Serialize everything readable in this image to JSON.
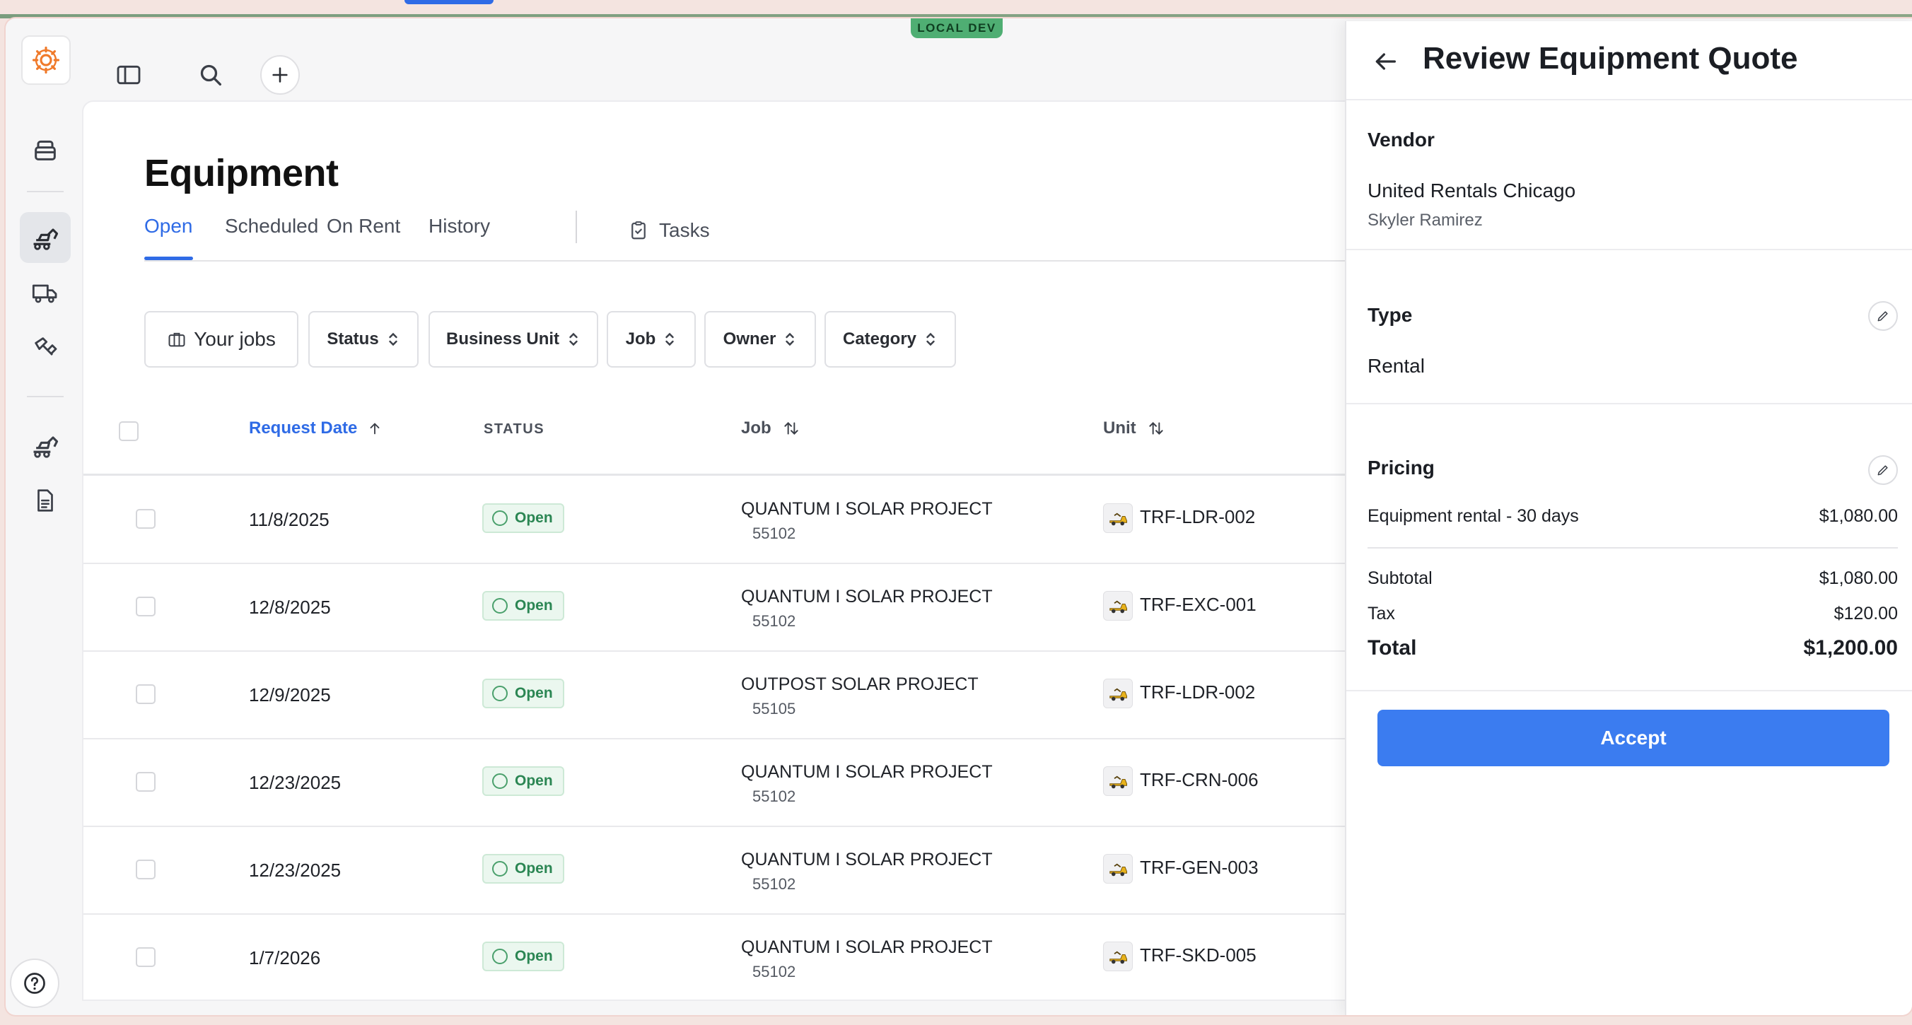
{
  "env_badge": "LOCAL DEV",
  "page": {
    "title": "Equipment"
  },
  "tabs": [
    {
      "label": "Open",
      "active": true
    },
    {
      "label": "Scheduled"
    },
    {
      "label": "On Rent"
    },
    {
      "label": "History"
    },
    {
      "label": "Tasks",
      "icon": "clipboard-check-icon"
    }
  ],
  "filters": {
    "your_jobs": "Your jobs",
    "status": "Status",
    "business_unit": "Business Unit",
    "job": "Job",
    "owner": "Owner",
    "category": "Category"
  },
  "table": {
    "columns": {
      "request_date": "Request Date",
      "status": "STATUS",
      "job": "Job",
      "unit": "Unit"
    },
    "rows": [
      {
        "date": "11/8/2025",
        "status": "Open",
        "job_name": "QUANTUM I SOLAR PROJECT",
        "job_number": "55102",
        "unit": "TRF-LDR-002"
      },
      {
        "date": "12/8/2025",
        "status": "Open",
        "job_name": "QUANTUM I SOLAR PROJECT",
        "job_number": "55102",
        "unit": "TRF-EXC-001"
      },
      {
        "date": "12/9/2025",
        "status": "Open",
        "job_name": "OUTPOST SOLAR PROJECT",
        "job_number": "55105",
        "unit": "TRF-LDR-002"
      },
      {
        "date": "12/23/2025",
        "status": "Open",
        "job_name": "QUANTUM I SOLAR PROJECT",
        "job_number": "55102",
        "unit": "TRF-CRN-006"
      },
      {
        "date": "12/23/2025",
        "status": "Open",
        "job_name": "QUANTUM I SOLAR PROJECT",
        "job_number": "55102",
        "unit": "TRF-GEN-003"
      },
      {
        "date": "1/7/2026",
        "status": "Open",
        "job_name": "QUANTUM I SOLAR PROJECT",
        "job_number": "55102",
        "unit": "TRF-SKD-005"
      }
    ]
  },
  "panel": {
    "title": "Review Equipment Quote",
    "vendor_label": "Vendor",
    "vendor_name": "United Rentals Chicago",
    "vendor_contact": "Skyler Ramirez",
    "type_label": "Type",
    "type_value": "Rental",
    "pricing_label": "Pricing",
    "line_item": "Equipment rental - 30 days",
    "line_amount": "$1,080.00",
    "subtotal_label": "Subtotal",
    "subtotal_value": "$1,080.00",
    "tax_label": "Tax",
    "tax_value": "$120.00",
    "total_label": "Total",
    "total_value": "$1,200.00",
    "accept_label": "Accept"
  },
  "colors": {
    "accent": "#2f6be6",
    "status_open": "#2b8653",
    "env_badge": "#4fae73"
  }
}
